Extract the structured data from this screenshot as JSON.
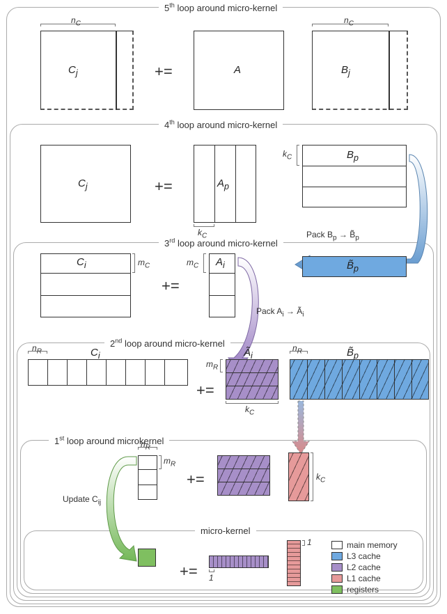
{
  "loops": {
    "l5": "5<sup>th</sup> loop around micro-kernel",
    "l4": "4<sup>th</sup> loop around micro-kernel",
    "l3": "3<sup>rd</sup> loop around micro-kernel",
    "l2": "2<sup>nd</sup> loop around micro-kernel",
    "l1": "1<sup>st</sup> loop around microkernel",
    "mk": "micro-kernel"
  },
  "op": {
    "plus_eq": "+="
  },
  "dims": {
    "nC": "n<sub>C</sub>",
    "kC": "k<sub>C</sub>",
    "mC": "m<sub>C</sub>",
    "nR": "n<sub>R</sub>",
    "mR": "m<sub>R</sub>",
    "one": "1"
  },
  "mats": {
    "Cj": "C<sub>j</sub>",
    "A": "A",
    "Bj": "B<sub>j</sub>",
    "Ap": "A<sub>p</sub>",
    "Bp": "B<sub>p</sub>",
    "Ci": "C<sub>i</sub>",
    "Ai": "A<sub>i</sub>",
    "Atilde_i": "Ã<sub>i</sub>",
    "Btilde_p": "B̃<sub>p</sub>",
    "Cij": "C<sub>ij</sub>"
  },
  "labels": {
    "pack_B": "Pack B<sub>p</sub> → B̃<sub>p</sub>",
    "pack_A": "Pack A<sub>i</sub> → Ã<sub>i</sub>",
    "update_C": "Update C<sub>ij</sub>"
  },
  "legend": {
    "main": "main memory",
    "l3": "L3 cache",
    "l2": "L2 cache",
    "l1": "L1 cache",
    "reg": "registers"
  },
  "colors": {
    "main": "#ffffff",
    "l3": "#6fa9e0",
    "l2": "#a78fc8",
    "l1": "#e69a9a",
    "reg": "#7fbf60"
  }
}
